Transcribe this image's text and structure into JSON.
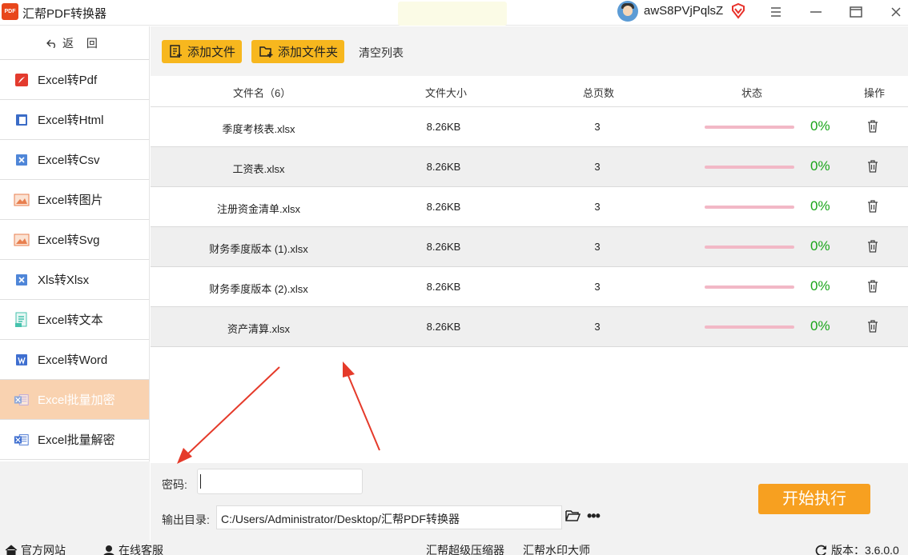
{
  "app": {
    "logo_text": "PDF",
    "title": "汇帮PDF转换器",
    "username": "awS8PVjPqlsZ"
  },
  "sidebar": {
    "back_label": "返 回",
    "items": [
      {
        "label": "Excel转Pdf",
        "icon": "pdf-icon"
      },
      {
        "label": "Excel转Html",
        "icon": "html-icon"
      },
      {
        "label": "Excel转Csv",
        "icon": "csv-icon"
      },
      {
        "label": "Excel转图片",
        "icon": "image-icon"
      },
      {
        "label": "Excel转Svg",
        "icon": "svg-icon"
      },
      {
        "label": "Xls转Xlsx",
        "icon": "xlsx-icon"
      },
      {
        "label": "Excel转文本",
        "icon": "text-icon"
      },
      {
        "label": "Excel转Word",
        "icon": "word-icon"
      },
      {
        "label": "Excel批量加密",
        "icon": "encrypt-icon",
        "active": true
      },
      {
        "label": "Excel批量解密",
        "icon": "decrypt-icon"
      }
    ]
  },
  "toolbar": {
    "add_file_label": "添加文件",
    "add_folder_label": "添加文件夹",
    "clear_label": "清空列表"
  },
  "table": {
    "headers": {
      "name": "文件名（6）",
      "size": "文件大小",
      "pages": "总页数",
      "status": "状态",
      "action": "操作"
    },
    "rows": [
      {
        "name": "季度考核表.xlsx",
        "size": "8.26KB",
        "pages": "3",
        "progress": 0,
        "pct": "0%"
      },
      {
        "name": "工资表.xlsx",
        "size": "8.26KB",
        "pages": "3",
        "progress": 0,
        "pct": "0%"
      },
      {
        "name": "注册资金清单.xlsx",
        "size": "8.26KB",
        "pages": "3",
        "progress": 0,
        "pct": "0%"
      },
      {
        "name": "财务季度版本 (1).xlsx",
        "size": "8.26KB",
        "pages": "3",
        "progress": 0,
        "pct": "0%"
      },
      {
        "name": "财务季度版本 (2).xlsx",
        "size": "8.26KB",
        "pages": "3",
        "progress": 0,
        "pct": "0%"
      },
      {
        "name": "资产清算.xlsx",
        "size": "8.26KB",
        "pages": "3",
        "progress": 0,
        "pct": "0%"
      }
    ]
  },
  "form": {
    "password_label": "密码:",
    "password_value": "",
    "output_label": "输出目录:",
    "output_path": "C:/Users/Administrator/Desktop/汇帮PDF转换器",
    "start_label": "开始执行"
  },
  "statusbar": {
    "website": "官方网站",
    "support": "在线客服",
    "compressor": "汇帮超级压缩器",
    "watermark": "汇帮水印大师",
    "version": "版本：3.6.0.0"
  },
  "colors": {
    "accent_yellow": "#f7b71e",
    "start_orange": "#f7a020",
    "active_sidebar": "#f9d2b0",
    "progress_green": "#1aa51a",
    "annotation_red": "#e53a2a"
  }
}
